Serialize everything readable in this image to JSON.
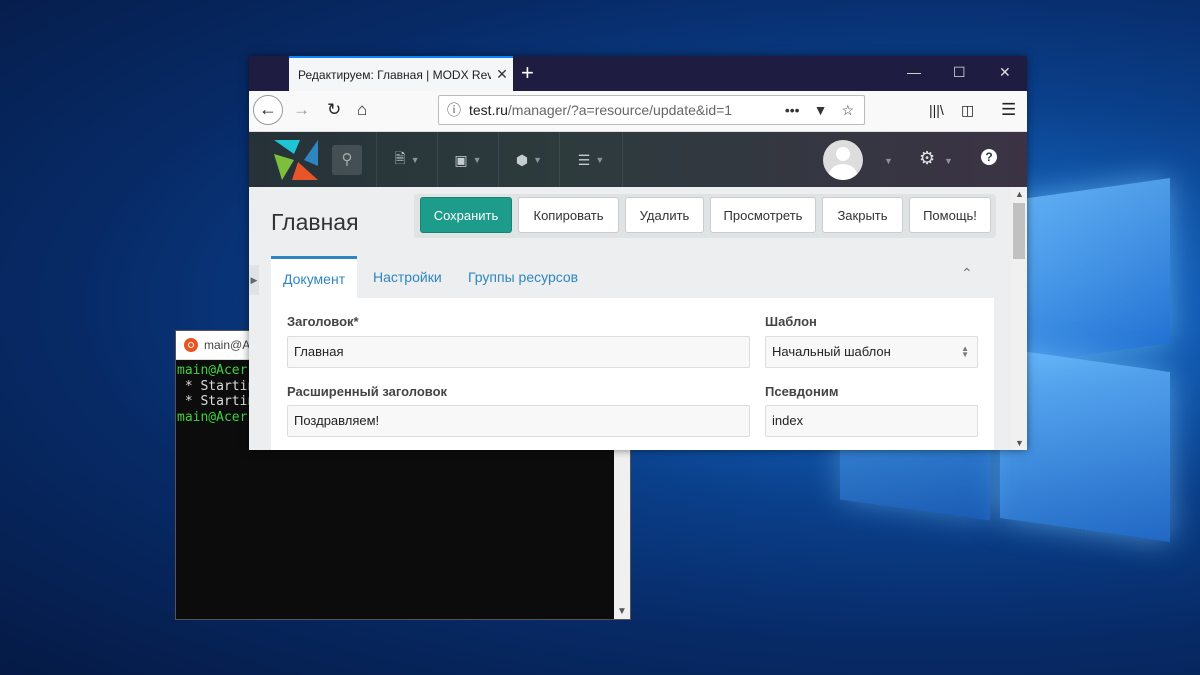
{
  "terminal": {
    "title": "main@A",
    "lines": [
      {
        "text": "main@Acer",
        "style": "g"
      },
      {
        "text": " * Startin",
        "style": ""
      },
      {
        "text": " * Startin",
        "style": ""
      },
      {
        "text": "main@Acer",
        "style": "g"
      }
    ]
  },
  "browser": {
    "tab_title": "Редактируем: Главная | MODX Rev",
    "tab_close": "✕",
    "new_tab": "+",
    "url_host": "test.ru",
    "url_path": "/manager/?a=resource/update&id=1"
  },
  "modx": {
    "page_title": "Главная",
    "actions": {
      "save": "Сохранить",
      "copy": "Копировать",
      "delete": "Удалить",
      "view": "Просмотреть",
      "close": "Закрыть",
      "help": "Помощь!"
    },
    "tabs": {
      "document": "Документ",
      "settings": "Настройки",
      "groups": "Группы ресурсов"
    },
    "fields": {
      "title_label": "Заголовок*",
      "title_value": "Главная",
      "longtitle_label": "Расширенный заголовок",
      "longtitle_value": "Поздравляем!",
      "template_label": "Шаблон",
      "template_value": "Начальный шаблон",
      "alias_label": "Псевдоним",
      "alias_value": "index"
    }
  },
  "colors": {
    "primary_button": "#1d9c8c",
    "link": "#2e86c1",
    "tab_accent": "#0a84ff"
  }
}
